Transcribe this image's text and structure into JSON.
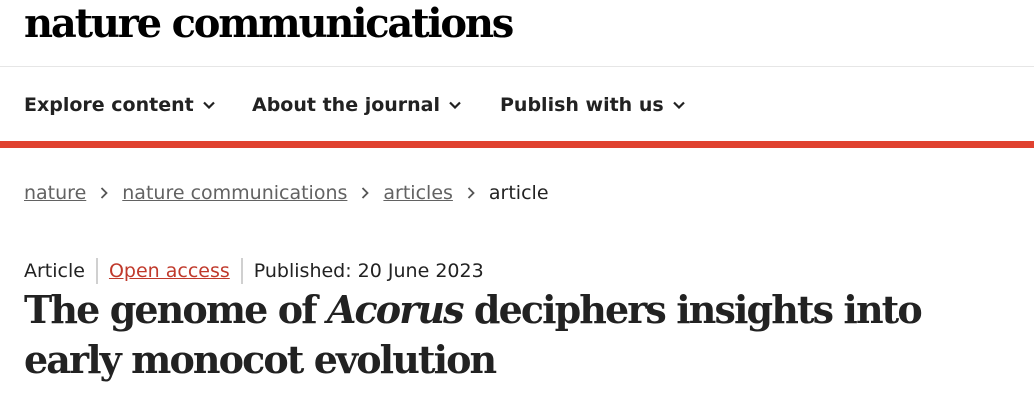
{
  "header": {
    "logo": "nature communications"
  },
  "nav": {
    "items": [
      {
        "label": "Explore content"
      },
      {
        "label": "About the journal"
      },
      {
        "label": "Publish with us"
      }
    ]
  },
  "colors": {
    "accent_bar": "#e0412f",
    "open_access": "#c0392b"
  },
  "breadcrumb": {
    "items": [
      {
        "label": "nature"
      },
      {
        "label": "nature communications"
      },
      {
        "label": "articles"
      }
    ],
    "current": "article"
  },
  "article": {
    "type": "Article",
    "access": "Open access",
    "published": "Published: 20 June 2023",
    "title_before": "The genome of ",
    "title_italic": "Acorus",
    "title_after": " deciphers insights into early monocot evolution"
  }
}
